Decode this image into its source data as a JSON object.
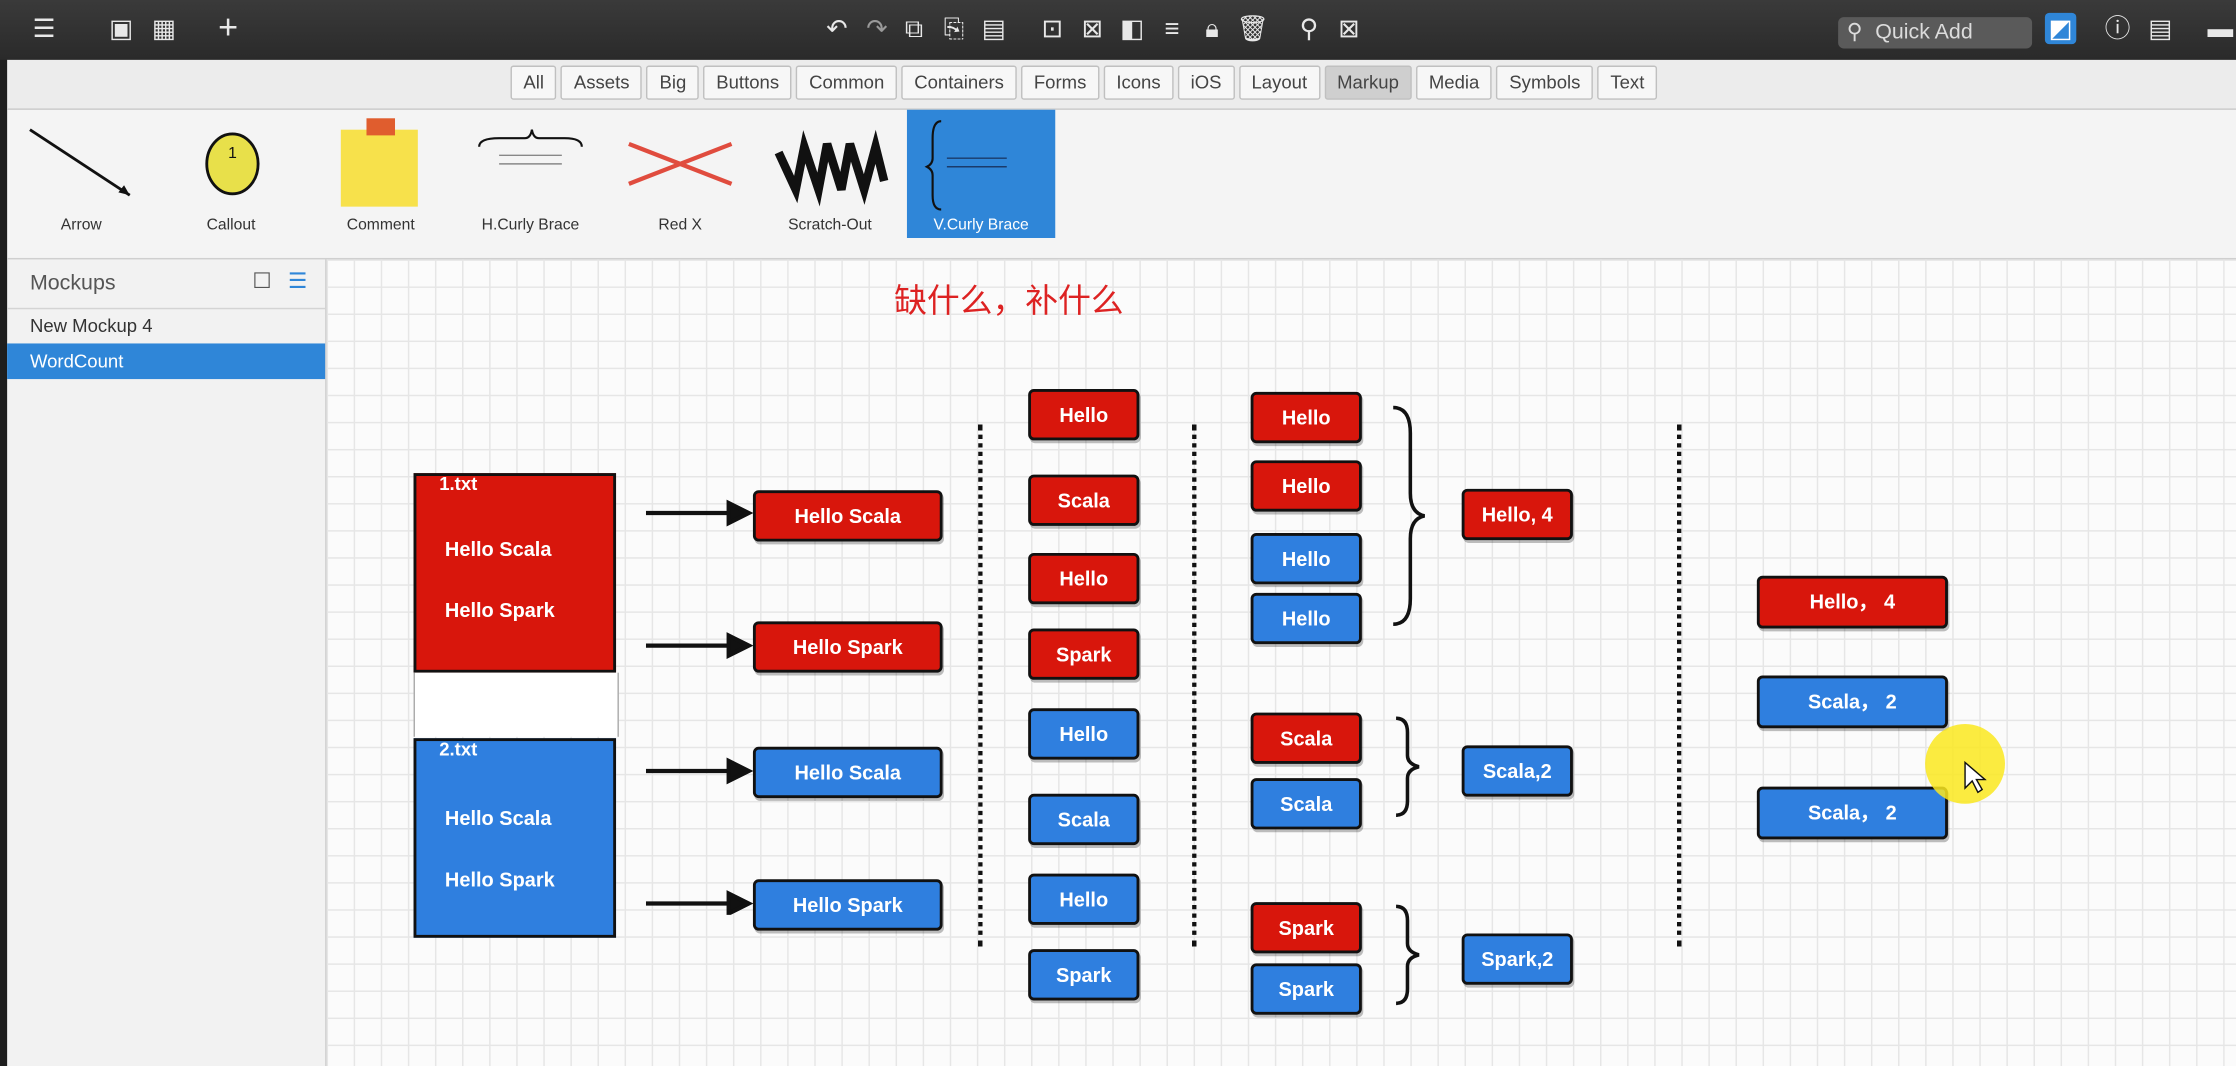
{
  "topbar": {
    "quick_add_placeholder": "Quick Add"
  },
  "filter_tabs": [
    "All",
    "Assets",
    "Big",
    "Buttons",
    "Common",
    "Containers",
    "Forms",
    "Icons",
    "iOS",
    "Layout",
    "Markup",
    "Media",
    "Symbols",
    "Text"
  ],
  "filter_active": "Markup",
  "library": [
    {
      "label": "Arrow"
    },
    {
      "label": "Callout"
    },
    {
      "label": "Comment"
    },
    {
      "label": "H.Curly Brace"
    },
    {
      "label": "Red X"
    },
    {
      "label": "Scratch-Out"
    },
    {
      "label": "V.Curly Brace",
      "selected": true
    }
  ],
  "mockups_panel": {
    "title": "Mockups",
    "items": [
      {
        "label": "New Mockup 4"
      },
      {
        "label": "WordCount",
        "selected": true
      }
    ]
  },
  "canvas": {
    "annotation": "缺什么，补什么",
    "files": [
      {
        "name": "1.txt",
        "lines": [
          "Hello Scala",
          "Hello Spark"
        ],
        "color": "red"
      },
      {
        "name": "2.txt",
        "lines": [
          "Hello Scala",
          "Hello Spark"
        ],
        "color": "blue"
      }
    ],
    "lines_col": [
      "Hello Scala",
      "Hello Spark",
      "Hello Scala",
      "Hello Spark"
    ],
    "words_col": [
      "Hello",
      "Scala",
      "Hello",
      "Spark",
      "Hello",
      "Scala",
      "Hello",
      "Spark"
    ],
    "grouped_col": [
      "Hello",
      "Hello",
      "Hello",
      "Hello",
      "Scala",
      "Scala",
      "Spark",
      "Spark"
    ],
    "counts_col": [
      "Hello, 4",
      "Scala,2",
      "Spark,2"
    ],
    "results_col": [
      "Hello， 4",
      "Scala， 2",
      "Scala， 2"
    ]
  },
  "colors": {
    "red": "#d8160c",
    "blue": "#2f7fdf",
    "selection": "#2f86d8",
    "annotation": "#dd2222"
  }
}
